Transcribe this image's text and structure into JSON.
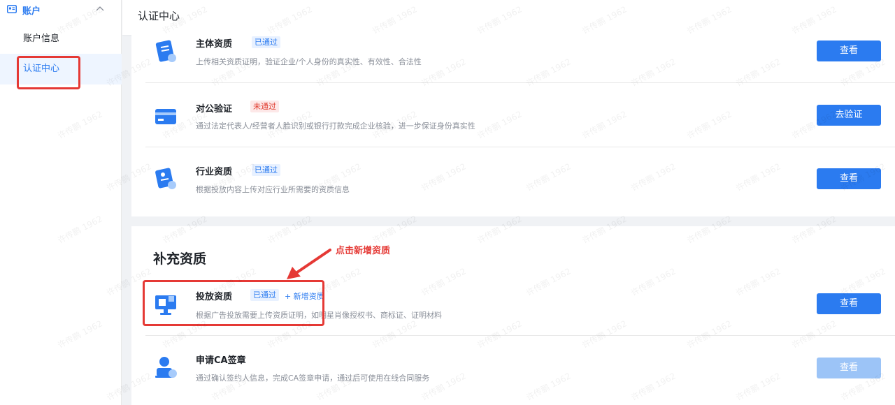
{
  "sidebar": {
    "group_label": "账户",
    "items": [
      {
        "label": "账户信息"
      },
      {
        "label": "认证中心"
      }
    ]
  },
  "header": {
    "title": "认证中心"
  },
  "main": {
    "basic": [
      {
        "name": "主体资质",
        "status": "已通过",
        "desc": "上传相关资质证明，验证企业/个人身份的真实性、有效性、合法性",
        "button": "查看"
      },
      {
        "name": "对公验证",
        "status": "未通过",
        "desc": "通过法定代表人/经营者人脸识别或银行打款完成企业核验，进一步保证身份真实性",
        "button": "去验证"
      },
      {
        "name": "行业资质",
        "status": "已通过",
        "desc": "根据投放内容上传对应行业所需要的资质信息",
        "button": "查看"
      }
    ],
    "supplement": {
      "title": "补充资质",
      "items": [
        {
          "name": "投放资质",
          "status": "已通过",
          "add_link": "+ 新增资质",
          "desc": "根据广告投放需要上传资质证明，如明星肖像授权书、商标证、证明材料",
          "button": "查看"
        },
        {
          "name": "申请CA签章",
          "desc": "通过确认签约人信息，完成CA签章申请，通过后可使用在线合同服务",
          "button": "查看"
        }
      ]
    }
  },
  "annotation": {
    "text": "点击新增资质"
  },
  "watermark": "许传鹏 1962",
  "colors": {
    "accent": "#2b7bf0",
    "annotation": "#e53935",
    "fail": "#e0392b"
  }
}
